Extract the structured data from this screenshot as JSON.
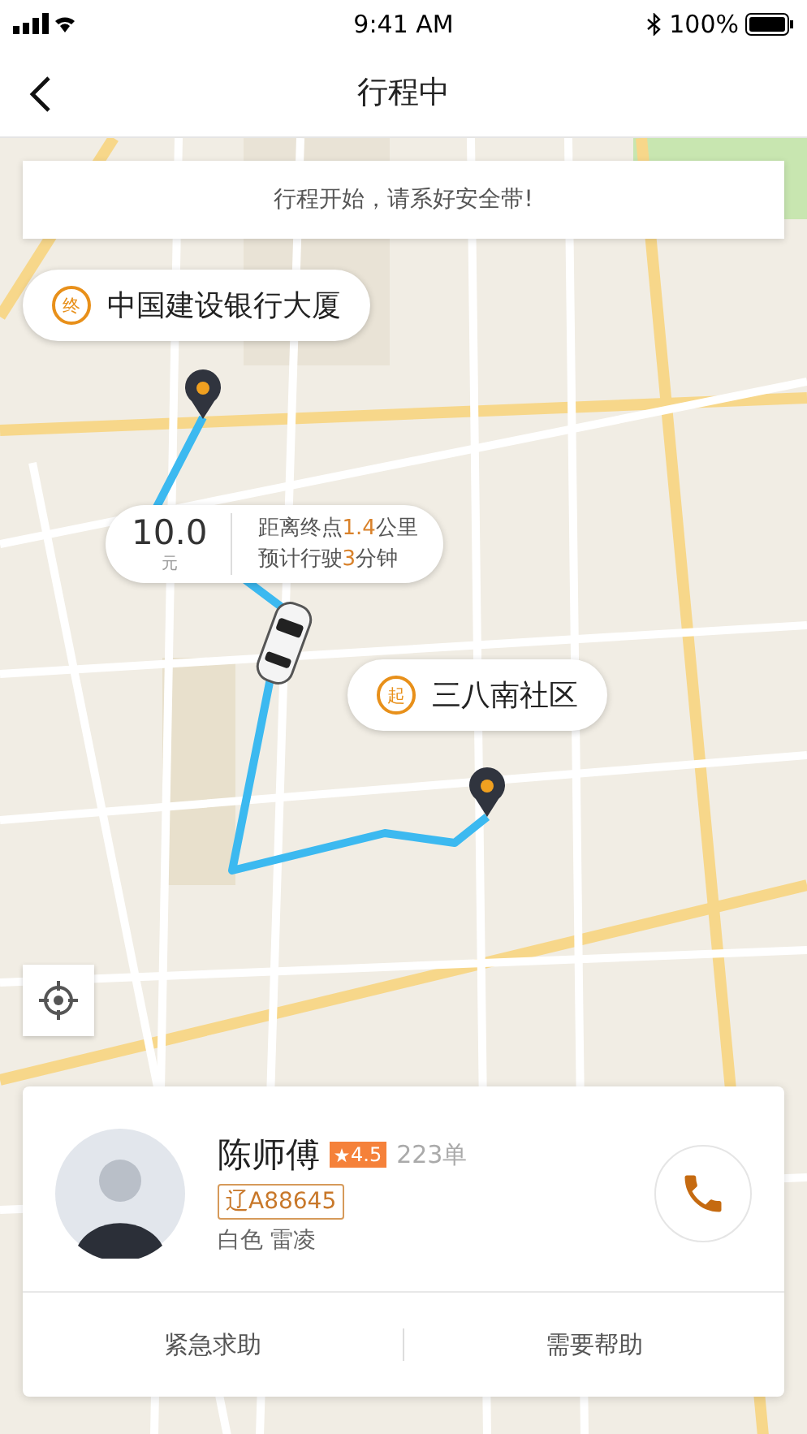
{
  "status_bar": {
    "time": "9:41 AM",
    "battery": "100%"
  },
  "nav": {
    "title": "行程中"
  },
  "notice": "行程开始，请系好安全带!",
  "destination": {
    "badge": "终",
    "name": "中国建设银行大厦"
  },
  "trip_info": {
    "fare": "10.0",
    "unit": "元",
    "lines": [
      [
        {
          "text": "距离终点",
          "highlight": false
        },
        {
          "text": "1.4",
          "highlight": true
        },
        {
          "text": "公里",
          "highlight": false
        }
      ],
      [
        {
          "text": "预计行驶",
          "highlight": false
        },
        {
          "text": "3",
          "highlight": true
        },
        {
          "text": "分钟",
          "highlight": false
        }
      ]
    ]
  },
  "origin": {
    "badge": "起",
    "name": "三八南社区"
  },
  "driver": {
    "name": "陈师傅",
    "rating": "4.5",
    "orders": "223单",
    "plate": "辽A88645",
    "car": "白色 雷凌"
  },
  "actions": [
    "紧急求助",
    "需要帮助"
  ]
}
